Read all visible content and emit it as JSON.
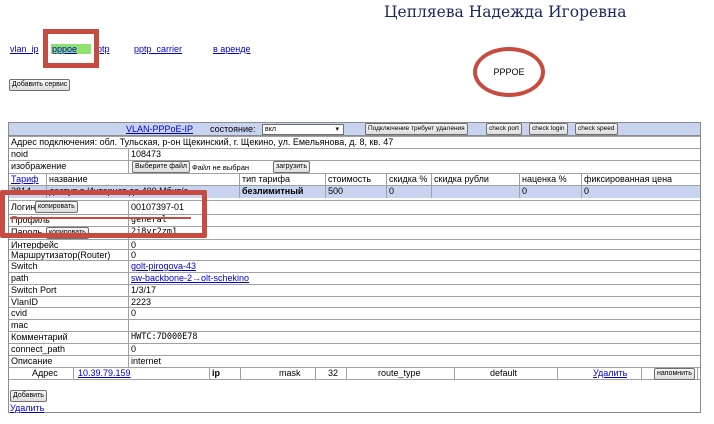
{
  "header": {
    "name": "Цепляева Надежда Игоревна"
  },
  "tabs": [
    {
      "label": "vlan_ip"
    },
    {
      "label": "pppoe"
    },
    {
      "label": "ptp"
    },
    {
      "label": "pptp_carrier"
    },
    {
      "label": "в аренде"
    }
  ],
  "service_label": "PPPOE",
  "add_service_label": "Добавить сервис",
  "service_bar": {
    "name": "VLAN-PPPoE-IP",
    "state_label": "состояние:",
    "state_value": "вкл",
    "caret": "▾",
    "buttons": [
      "Подключение требует удаления",
      "check port",
      "check login",
      "check speed"
    ]
  },
  "address": "Адрес подключения: обл. Тульская, р-он Щекинский, г. Щекино, ул. Емельянова, д. 8, кв. 47",
  "noid": {
    "label": "noid",
    "value": "108473"
  },
  "image_row": {
    "label": "изображение",
    "choose_label": "Выберите файл",
    "no_file": "Файл не выбран",
    "upload_label": "загрузить"
  },
  "tariff": {
    "headers": [
      "Тариф",
      "название",
      "тип тарифа",
      "стоимость",
      "скидка %",
      "скидка рубли",
      "наценка %",
      "фиксированная цена"
    ],
    "row": [
      "2814",
      "доступ в Интернет до 400 Мбит/с",
      "безлимитный",
      "500",
      "0",
      "",
      "0",
      "0"
    ]
  },
  "fields": [
    {
      "label": "Логин",
      "button": "копировать",
      "value": "00107397-01"
    },
    {
      "label": "Профиль",
      "value": "general"
    },
    {
      "label": "Пароль",
      "button": "копировать",
      "value": "2j8yr2zm1"
    },
    {
      "label": "Интерфейс",
      "value": "0"
    },
    {
      "label": "Маршрутизатор(Router)",
      "value": "0"
    },
    {
      "label": "Switch",
      "value": "golt-pirogova-43",
      "link": true
    },
    {
      "label": "path",
      "value": "sw-backbone-2→olt-schekino",
      "link": true
    },
    {
      "label": "Switch Port",
      "value": "1/3/17"
    },
    {
      "label": "VlanID",
      "value": "2223"
    },
    {
      "label": "cvid",
      "value": "0"
    },
    {
      "label": "mac",
      "value": ""
    },
    {
      "label": "Комментарий",
      "value": "HWTC:7D000E78"
    },
    {
      "label": "connect_path",
      "value": "0"
    },
    {
      "label": "Описание",
      "value": "internet"
    }
  ],
  "ip_row": {
    "label": "Адрес",
    "address": "10.39.79.159",
    "type": "ip",
    "mask_label": "mask",
    "mask": "32",
    "route_type_label": "route_type",
    "route_type": "default",
    "delete_label": "Удалить",
    "remind_label": "напомнить"
  },
  "add_label": "Добавить",
  "delete_label": "Удалить",
  "colors": {
    "accent_red": "#c84b41",
    "tab_active": "#8ee36e",
    "header_blue": "#c8d3f0",
    "link": "#0000cc"
  },
  "icons": {
    "caret": "chevron-down-icon"
  }
}
